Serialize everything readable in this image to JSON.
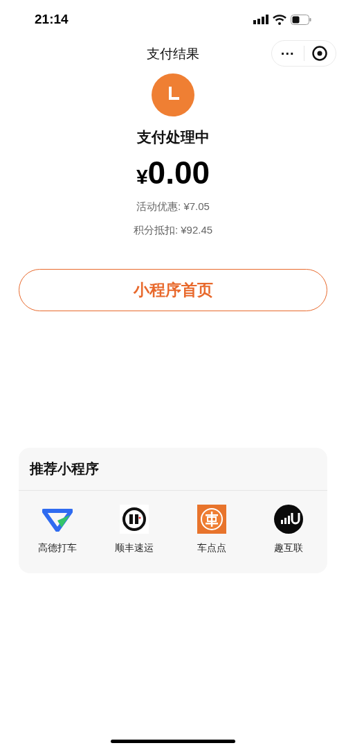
{
  "status_bar": {
    "time": "21:14"
  },
  "nav": {
    "title": "支付结果",
    "more": "···"
  },
  "result": {
    "status": "支付处理中",
    "currency": "¥",
    "amount": "0.00",
    "details": [
      "活动优惠: ¥7.05",
      "积分抵扣: ¥92.45"
    ]
  },
  "home_button": "小程序首页",
  "recommend": {
    "title": "推荐小程序",
    "apps": [
      {
        "kind": "triangle",
        "name": "高德打车"
      },
      {
        "kind": "sf",
        "name": "顺丰速运"
      },
      {
        "kind": "car",
        "name": "车点点"
      },
      {
        "kind": "signal",
        "name": "趣互联"
      }
    ]
  }
}
